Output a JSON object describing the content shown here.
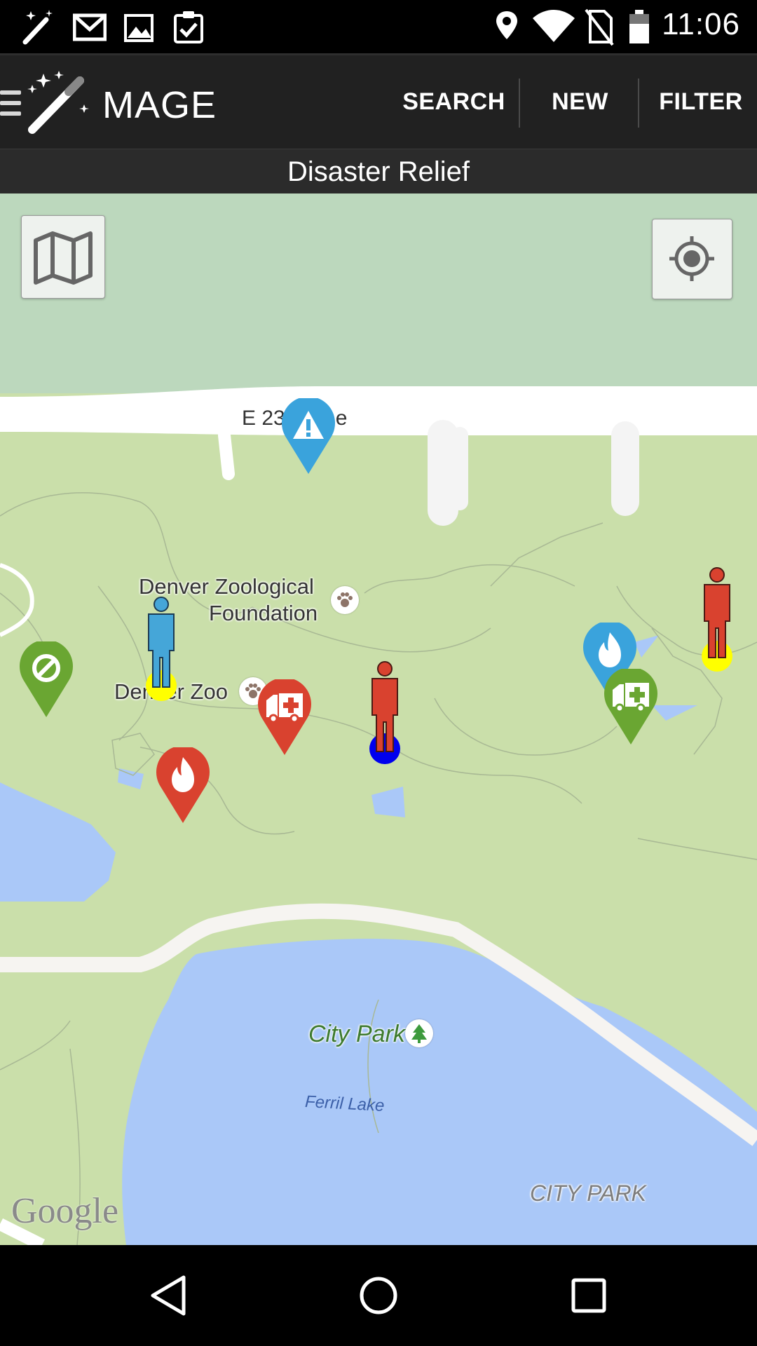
{
  "status_bar": {
    "time": "11:06",
    "left_icons": [
      "magic-wand-icon",
      "gmail-icon",
      "image-icon",
      "clipboard-check-icon"
    ],
    "right_icons": [
      "location-icon",
      "wifi-icon",
      "no-sim-icon",
      "battery-icon"
    ]
  },
  "action_bar": {
    "app_name": "MAGE",
    "actions": {
      "search": "SEARCH",
      "new": "NEW",
      "filter": "FILTER"
    }
  },
  "event": {
    "name": "Disaster Relief"
  },
  "map": {
    "labels": {
      "street": "E 23",
      "street_suffix": "e",
      "zoo_foundation_line1": "Denver Zoological",
      "zoo_foundation_line2": "Foundation",
      "zoo": "Denver Zoo",
      "city_park": "City Park",
      "lake": "Ferril Lake",
      "city_park_region": "CITY PARK",
      "attribution": "Google"
    },
    "markers": [
      {
        "type": "warning",
        "color": "#3aa3dc"
      },
      {
        "type": "blocked",
        "color": "#6aa632"
      },
      {
        "type": "person",
        "color": "#45a6d8",
        "dot": "#ffff00"
      },
      {
        "type": "ambulance",
        "color": "#d9422f"
      },
      {
        "type": "fire",
        "color": "#d9422f"
      },
      {
        "type": "person",
        "color": "#d9422f",
        "dot": "#0000ee"
      },
      {
        "type": "fire",
        "color": "#3aa3dc"
      },
      {
        "type": "ambulance",
        "color": "#6aa632"
      },
      {
        "type": "person",
        "color": "#d9422f",
        "dot": "#ffff00"
      }
    ],
    "colors": {
      "water": "#aac8f8",
      "park": "#cadfaa",
      "upper": "#bcd8bd",
      "road": "#ffffff"
    }
  },
  "nav_bar": {
    "icons": [
      "back-icon",
      "home-icon",
      "recents-icon"
    ]
  }
}
